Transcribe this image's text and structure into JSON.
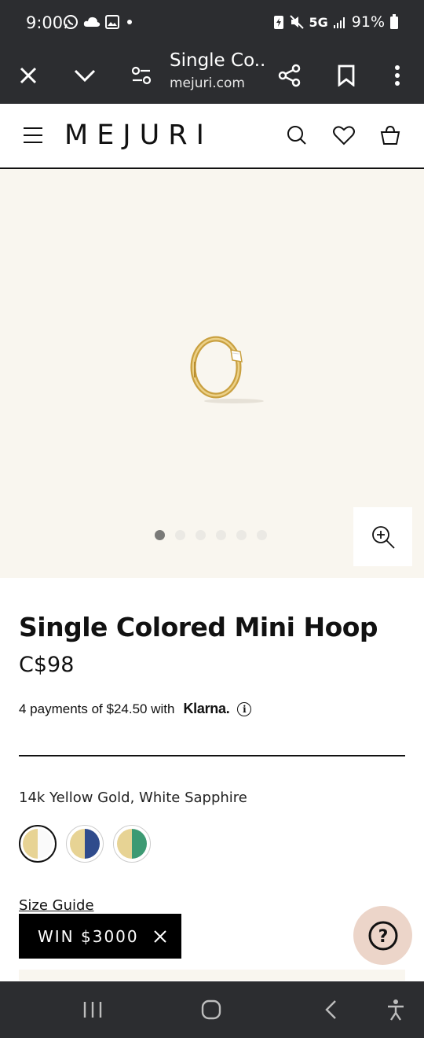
{
  "status_bar": {
    "time": "9:00",
    "network": "5G",
    "battery": "91%",
    "icons": [
      "whatsapp-icon",
      "cloud-icon",
      "gallery-icon",
      "dot-icon",
      "battery-saver-icon",
      "mute-icon",
      "signal-icon",
      "battery-icon"
    ]
  },
  "browser": {
    "page_title": "Single Co...",
    "url": "mejuri.com",
    "icons": [
      "close-icon",
      "chevron-down-icon",
      "page-settings-icon",
      "share-icon",
      "bookmark-icon",
      "more-icon"
    ]
  },
  "site_header": {
    "logo": "MEJURI",
    "icons": [
      "menu-icon",
      "search-icon",
      "heart-icon",
      "bag-icon"
    ]
  },
  "gallery": {
    "image_count": 6,
    "active_index": 0
  },
  "product": {
    "title": "Single Colored Mini Hoop",
    "price": "C$98",
    "klarna_text": "4 payments of $24.50 with",
    "klarna_brand": "Klarna.",
    "variant_name": "14k Yellow Gold, White Sapphire",
    "swatches": [
      {
        "left": "#e7d394",
        "right": "#fafafa",
        "selected": true
      },
      {
        "left": "#e7d394",
        "right": "#2f4b8c",
        "selected": false
      },
      {
        "left": "#e7d394",
        "right": "#3d9a73",
        "selected": false
      }
    ],
    "size_guide": "Size Guide"
  },
  "promo": {
    "text": "WIN $3000"
  },
  "help": {
    "label": "?"
  },
  "colors": {
    "system_bar": "#2c2d30",
    "hero_bg": "#f9f6ef",
    "help_bg": "#ecd5c9",
    "gold": "#d8b049"
  }
}
